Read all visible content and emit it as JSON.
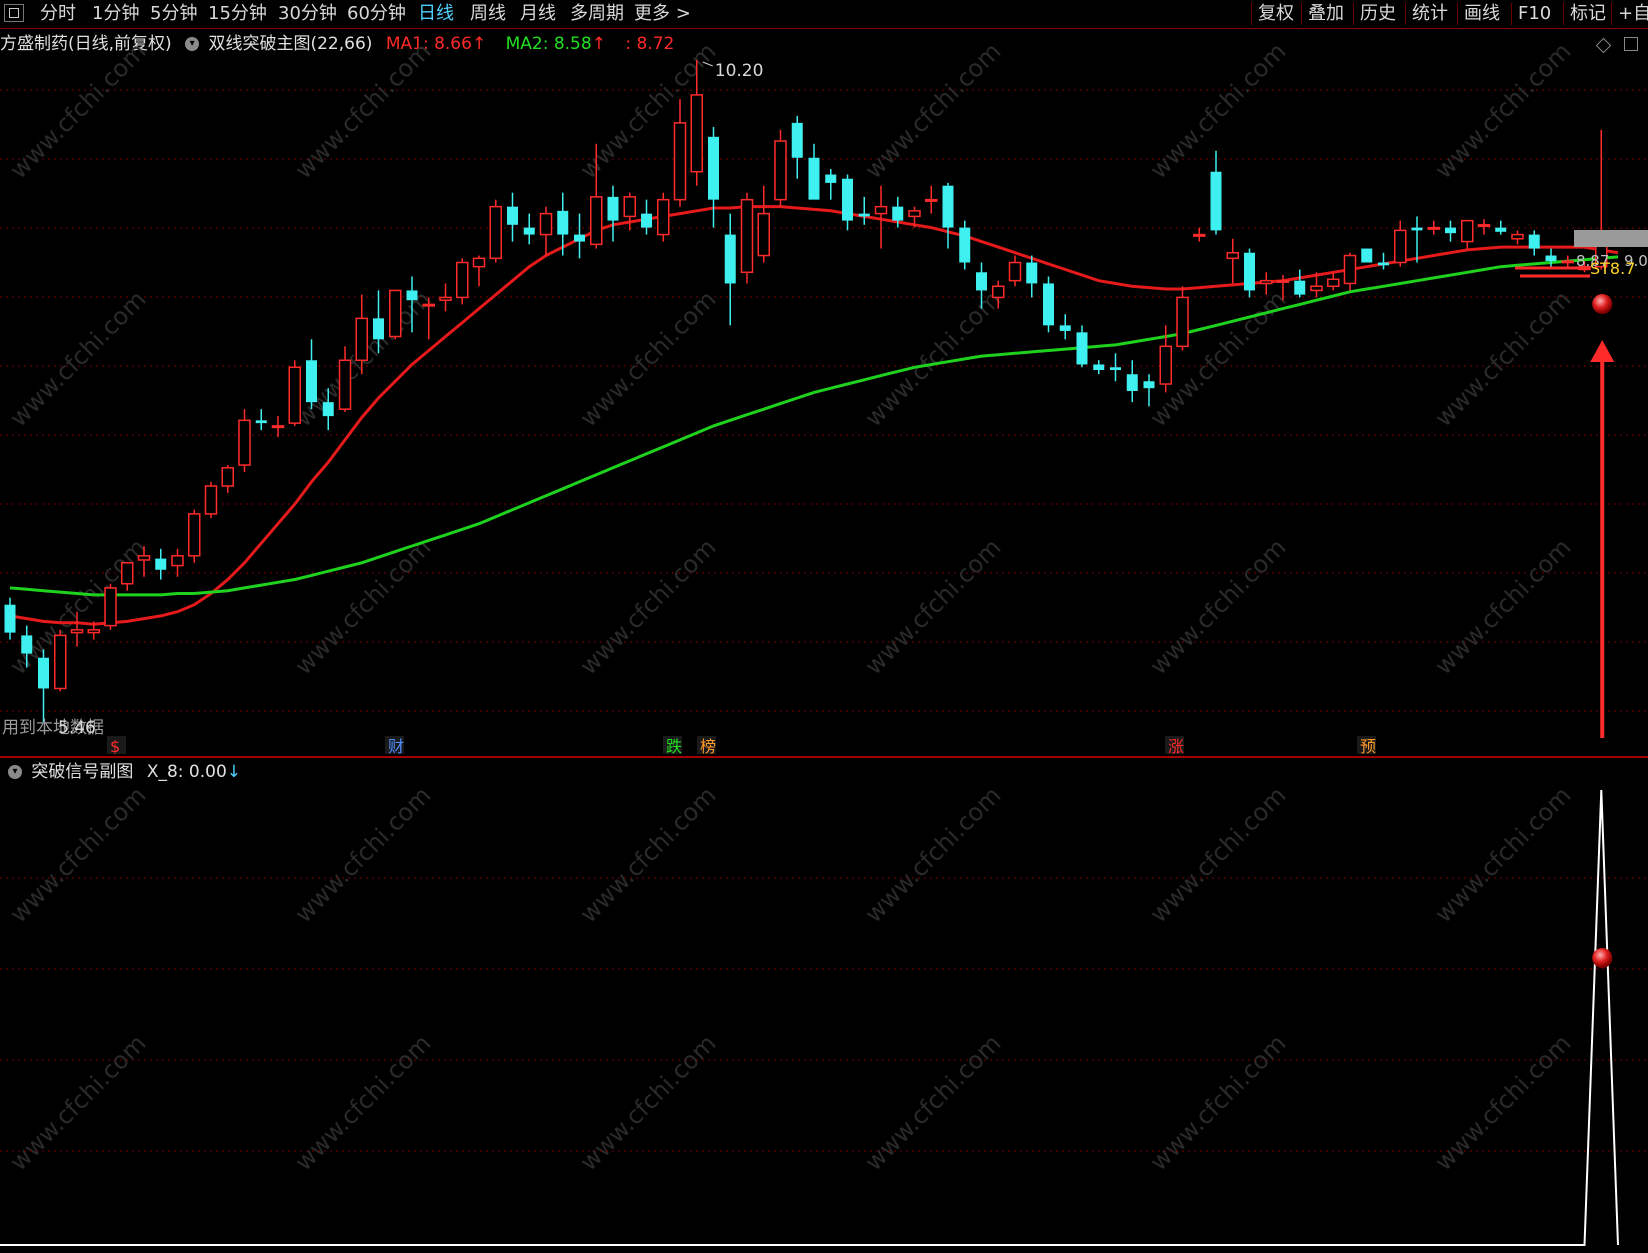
{
  "toolbar": {
    "left_items": [
      "分时",
      "1分钟",
      "5分钟",
      "15分钟",
      "30分钟",
      "60分钟",
      "日线",
      "周线",
      "月线",
      "多周期",
      "更多 >"
    ],
    "active_item": "日线",
    "right_items": [
      "复权",
      "叠加",
      "历史",
      "统计",
      "画线",
      "F10",
      "标记",
      "+自"
    ]
  },
  "main_pane": {
    "stock_title": "方盛制药(日线,前复权)",
    "indicator_name": "双线突破主图(22,66)",
    "ma1_label": "MA1: 8.66",
    "ma2_label": "MA2: 8.58",
    "ma3_label": ": 8.72",
    "up_arrow": "↑",
    "high_label": "10.20",
    "low_label": "5.46",
    "bottom_left_text": "用到本地数据",
    "right_price_labels": [
      "8.87",
      "9.0",
      "ST8.7"
    ],
    "markers": [
      {
        "text": "$",
        "color": "#ff2a2a"
      },
      {
        "text": "财",
        "color": "#4f8fff"
      },
      {
        "text": "跌",
        "color": "#21e021"
      },
      {
        "text": "榜",
        "color": "#ff9a2a"
      },
      {
        "text": "涨",
        "color": "#ff2a2a"
      },
      {
        "text": "预",
        "color": "#ff9a2a"
      }
    ]
  },
  "sub_pane": {
    "title": "突破信号副图",
    "x8_label": "X_8: 0.00",
    "down_arrow": "↓"
  },
  "watermark": "www.cfchi.com",
  "colors": {
    "up_candle": "#ff2a2a",
    "down_candle": "#3ff0f0",
    "ma1": "#e61a1a",
    "ma2": "#1ed21e",
    "grid": "#7a0000",
    "signal_line": "#ffffff"
  },
  "chart_data": {
    "type": "candlestick",
    "ylim": [
      5.46,
      10.2
    ],
    "candles": [
      {
        "o": 6.3,
        "h": 6.35,
        "l": 6.05,
        "c": 6.1
      },
      {
        "o": 6.08,
        "h": 6.15,
        "l": 5.85,
        "c": 5.95
      },
      {
        "o": 5.92,
        "h": 5.98,
        "l": 5.46,
        "c": 5.7
      },
      {
        "o": 5.7,
        "h": 6.12,
        "l": 5.68,
        "c": 6.08
      },
      {
        "o": 6.1,
        "h": 6.25,
        "l": 6.0,
        "c": 6.12
      },
      {
        "o": 6.1,
        "h": 6.18,
        "l": 6.05,
        "c": 6.12
      },
      {
        "o": 6.15,
        "h": 6.45,
        "l": 6.12,
        "c": 6.42
      },
      {
        "o": 6.45,
        "h": 6.6,
        "l": 6.4,
        "c": 6.6
      },
      {
        "o": 6.62,
        "h": 6.72,
        "l": 6.5,
        "c": 6.65
      },
      {
        "o": 6.63,
        "h": 6.7,
        "l": 6.48,
        "c": 6.55
      },
      {
        "o": 6.58,
        "h": 6.7,
        "l": 6.5,
        "c": 6.65
      },
      {
        "o": 6.65,
        "h": 6.98,
        "l": 6.6,
        "c": 6.95
      },
      {
        "o": 6.95,
        "h": 7.18,
        "l": 6.92,
        "c": 7.15
      },
      {
        "o": 7.15,
        "h": 7.3,
        "l": 7.1,
        "c": 7.28
      },
      {
        "o": 7.3,
        "h": 7.7,
        "l": 7.25,
        "c": 7.62
      },
      {
        "o": 7.62,
        "h": 7.7,
        "l": 7.55,
        "c": 7.6
      },
      {
        "o": 7.58,
        "h": 7.65,
        "l": 7.5,
        "c": 7.58
      },
      {
        "o": 7.6,
        "h": 8.05,
        "l": 7.58,
        "c": 8.0
      },
      {
        "o": 8.05,
        "h": 8.2,
        "l": 7.7,
        "c": 7.75
      },
      {
        "o": 7.75,
        "h": 7.85,
        "l": 7.55,
        "c": 7.65
      },
      {
        "o": 7.7,
        "h": 8.15,
        "l": 7.68,
        "c": 8.05
      },
      {
        "o": 8.05,
        "h": 8.52,
        "l": 7.95,
        "c": 8.35
      },
      {
        "o": 8.35,
        "h": 8.55,
        "l": 8.1,
        "c": 8.2
      },
      {
        "o": 8.22,
        "h": 8.55,
        "l": 8.2,
        "c": 8.55
      },
      {
        "o": 8.55,
        "h": 8.65,
        "l": 8.25,
        "c": 8.48
      },
      {
        "o": 8.45,
        "h": 8.5,
        "l": 8.2,
        "c": 8.45
      },
      {
        "o": 8.48,
        "h": 8.6,
        "l": 8.4,
        "c": 8.5
      },
      {
        "o": 8.5,
        "h": 8.78,
        "l": 8.45,
        "c": 8.75
      },
      {
        "o": 8.72,
        "h": 8.8,
        "l": 8.58,
        "c": 8.78
      },
      {
        "o": 8.78,
        "h": 9.2,
        "l": 8.75,
        "c": 9.15
      },
      {
        "o": 9.15,
        "h": 9.25,
        "l": 8.9,
        "c": 9.02
      },
      {
        "o": 9.0,
        "h": 9.1,
        "l": 8.88,
        "c": 8.95
      },
      {
        "o": 8.95,
        "h": 9.15,
        "l": 8.8,
        "c": 9.1
      },
      {
        "o": 9.12,
        "h": 9.25,
        "l": 8.8,
        "c": 8.95
      },
      {
        "o": 8.95,
        "h": 9.1,
        "l": 8.78,
        "c": 8.9
      },
      {
        "o": 8.88,
        "h": 9.6,
        "l": 8.85,
        "c": 9.22
      },
      {
        "o": 9.22,
        "h": 9.3,
        "l": 8.9,
        "c": 9.05
      },
      {
        "o": 9.08,
        "h": 9.25,
        "l": 8.98,
        "c": 9.22
      },
      {
        "o": 9.1,
        "h": 9.2,
        "l": 8.95,
        "c": 9.0
      },
      {
        "o": 8.95,
        "h": 9.25,
        "l": 8.9,
        "c": 9.2
      },
      {
        "o": 9.2,
        "h": 9.92,
        "l": 9.15,
        "c": 9.75
      },
      {
        "o": 9.4,
        "h": 10.2,
        "l": 9.3,
        "c": 9.95
      },
      {
        "o": 9.65,
        "h": 9.72,
        "l": 9.0,
        "c": 9.2
      },
      {
        "o": 8.95,
        "h": 9.1,
        "l": 8.3,
        "c": 8.6
      },
      {
        "o": 8.68,
        "h": 9.25,
        "l": 8.6,
        "c": 9.2
      },
      {
        "o": 8.8,
        "h": 9.3,
        "l": 8.75,
        "c": 9.1
      },
      {
        "o": 9.2,
        "h": 9.7,
        "l": 9.15,
        "c": 9.62
      },
      {
        "o": 9.75,
        "h": 9.8,
        "l": 9.35,
        "c": 9.5
      },
      {
        "o": 9.5,
        "h": 9.6,
        "l": 9.22,
        "c": 9.2
      },
      {
        "o": 9.38,
        "h": 9.42,
        "l": 9.2,
        "c": 9.32
      },
      {
        "o": 9.35,
        "h": 9.38,
        "l": 8.98,
        "c": 9.05
      },
      {
        "o": 9.1,
        "h": 9.22,
        "l": 9.02,
        "c": 9.08
      },
      {
        "o": 9.1,
        "h": 9.3,
        "l": 8.85,
        "c": 9.15
      },
      {
        "o": 9.15,
        "h": 9.22,
        "l": 9.0,
        "c": 9.05
      },
      {
        "o": 9.08,
        "h": 9.15,
        "l": 9.0,
        "c": 9.12
      },
      {
        "o": 9.2,
        "h": 9.3,
        "l": 9.1,
        "c": 9.2
      },
      {
        "o": 9.3,
        "h": 9.32,
        "l": 8.85,
        "c": 9.0
      },
      {
        "o": 9.0,
        "h": 9.05,
        "l": 8.7,
        "c": 8.75
      },
      {
        "o": 8.68,
        "h": 8.75,
        "l": 8.42,
        "c": 8.55
      },
      {
        "o": 8.5,
        "h": 8.62,
        "l": 8.42,
        "c": 8.58
      },
      {
        "o": 8.62,
        "h": 8.8,
        "l": 8.58,
        "c": 8.75
      },
      {
        "o": 8.75,
        "h": 8.8,
        "l": 8.5,
        "c": 8.6
      },
      {
        "o": 8.6,
        "h": 8.65,
        "l": 8.25,
        "c": 8.3
      },
      {
        "o": 8.3,
        "h": 8.38,
        "l": 8.2,
        "c": 8.26
      },
      {
        "o": 8.25,
        "h": 8.3,
        "l": 8.0,
        "c": 8.02
      },
      {
        "o": 8.02,
        "h": 8.05,
        "l": 7.95,
        "c": 7.98
      },
      {
        "o": 8.0,
        "h": 8.1,
        "l": 7.9,
        "c": 7.98
      },
      {
        "o": 7.95,
        "h": 8.05,
        "l": 7.75,
        "c": 7.83
      },
      {
        "o": 7.9,
        "h": 7.95,
        "l": 7.72,
        "c": 7.85
      },
      {
        "o": 7.88,
        "h": 8.3,
        "l": 7.82,
        "c": 8.15
      },
      {
        "o": 8.15,
        "h": 8.58,
        "l": 8.12,
        "c": 8.5
      },
      {
        "o": 8.95,
        "h": 9.0,
        "l": 8.9,
        "c": 8.95
      },
      {
        "o": 9.4,
        "h": 9.55,
        "l": 8.95,
        "c": 8.98
      },
      {
        "o": 8.78,
        "h": 8.92,
        "l": 8.6,
        "c": 8.82
      },
      {
        "o": 8.82,
        "h": 8.85,
        "l": 8.5,
        "c": 8.55
      },
      {
        "o": 8.6,
        "h": 8.68,
        "l": 8.52,
        "c": 8.62
      },
      {
        "o": 8.62,
        "h": 8.66,
        "l": 8.48,
        "c": 8.62
      },
      {
        "o": 8.62,
        "h": 8.7,
        "l": 8.5,
        "c": 8.52
      },
      {
        "o": 8.55,
        "h": 8.68,
        "l": 8.5,
        "c": 8.58
      },
      {
        "o": 8.58,
        "h": 8.68,
        "l": 8.55,
        "c": 8.63
      },
      {
        "o": 8.6,
        "h": 8.82,
        "l": 8.55,
        "c": 8.8
      },
      {
        "o": 8.85,
        "h": 8.85,
        "l": 8.75,
        "c": 8.75
      },
      {
        "o": 8.75,
        "h": 8.82,
        "l": 8.7,
        "c": 8.73
      },
      {
        "o": 8.75,
        "h": 9.05,
        "l": 8.72,
        "c": 8.98
      },
      {
        "o": 9.0,
        "h": 9.08,
        "l": 8.75,
        "c": 8.98
      },
      {
        "o": 9.0,
        "h": 9.05,
        "l": 8.95,
        "c": 9.0
      },
      {
        "o": 9.0,
        "h": 9.05,
        "l": 8.9,
        "c": 8.96
      },
      {
        "o": 8.9,
        "h": 9.05,
        "l": 8.85,
        "c": 9.05
      },
      {
        "o": 9.02,
        "h": 9.06,
        "l": 8.95,
        "c": 9.02
      },
      {
        "o": 9.0,
        "h": 9.05,
        "l": 8.95,
        "c": 8.97
      },
      {
        "o": 8.92,
        "h": 8.98,
        "l": 8.88,
        "c": 8.95
      },
      {
        "o": 8.95,
        "h": 8.98,
        "l": 8.8,
        "c": 8.85
      },
      {
        "o": 8.8,
        "h": 8.85,
        "l": 8.72,
        "c": 8.76
      },
      {
        "o": 8.76,
        "h": 8.8,
        "l": 8.72,
        "c": 8.76
      },
      {
        "o": 8.7,
        "h": 8.76,
        "l": 8.68,
        "c": 8.72
      },
      {
        "o": 8.72,
        "h": 9.7,
        "l": 8.7,
        "c": 8.87
      }
    ],
    "ma1": [
      6.22,
      6.2,
      6.18,
      6.17,
      6.17,
      6.16,
      6.17,
      6.18,
      6.2,
      6.22,
      6.25,
      6.3,
      6.38,
      6.48,
      6.6,
      6.74,
      6.88,
      7.02,
      7.18,
      7.32,
      7.48,
      7.64,
      7.78,
      7.9,
      8.02,
      8.12,
      8.22,
      8.32,
      8.42,
      8.52,
      8.62,
      8.72,
      8.8,
      8.86,
      8.92,
      8.98,
      9.02,
      9.04,
      9.06,
      9.08,
      9.1,
      9.12,
      9.14,
      9.14,
      9.15,
      9.15,
      9.15,
      9.14,
      9.13,
      9.12,
      9.1,
      9.08,
      9.06,
      9.04,
      9.02,
      9.0,
      8.97,
      8.94,
      8.9,
      8.86,
      8.82,
      8.78,
      8.74,
      8.7,
      8.66,
      8.62,
      8.6,
      8.58,
      8.57,
      8.56,
      8.56,
      8.57,
      8.58,
      8.59,
      8.6,
      8.61,
      8.62,
      8.64,
      8.66,
      8.68,
      8.7,
      8.72,
      8.74,
      8.76,
      8.78,
      8.8,
      8.82,
      8.84,
      8.85,
      8.86,
      8.86,
      8.86,
      8.86,
      8.86,
      8.86,
      8.84,
      8.82
    ],
    "ma2": [
      6.42,
      6.41,
      6.4,
      6.39,
      6.38,
      6.37,
      6.37,
      6.37,
      6.37,
      6.37,
      6.38,
      6.38,
      6.39,
      6.4,
      6.42,
      6.44,
      6.46,
      6.48,
      6.51,
      6.54,
      6.57,
      6.6,
      6.64,
      6.68,
      6.72,
      6.76,
      6.8,
      6.84,
      6.88,
      6.93,
      6.98,
      7.03,
      7.08,
      7.13,
      7.18,
      7.23,
      7.28,
      7.33,
      7.38,
      7.43,
      7.48,
      7.53,
      7.58,
      7.62,
      7.66,
      7.7,
      7.74,
      7.78,
      7.82,
      7.85,
      7.88,
      7.91,
      7.94,
      7.97,
      8.0,
      8.02,
      8.04,
      8.06,
      8.08,
      8.09,
      8.1,
      8.11,
      8.12,
      8.13,
      8.14,
      8.15,
      8.16,
      8.18,
      8.2,
      8.22,
      8.24,
      8.27,
      8.3,
      8.33,
      8.36,
      8.39,
      8.42,
      8.45,
      8.48,
      8.51,
      8.54,
      8.56,
      8.58,
      8.6,
      8.62,
      8.64,
      8.66,
      8.68,
      8.7,
      8.72,
      8.73,
      8.74,
      8.75,
      8.76,
      8.77,
      8.78,
      8.79
    ],
    "signal": {
      "peak_index": 95,
      "peak_value": 1,
      "baseline": 0
    }
  }
}
